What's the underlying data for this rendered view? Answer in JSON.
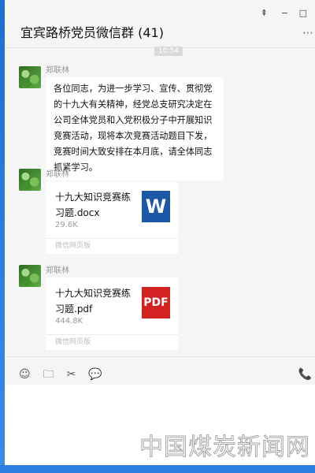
{
  "window": {
    "title": "宜宾路桥党员微信群 (41)",
    "controls": {
      "pin": "⇞",
      "minimize": "−",
      "maximize": "□",
      "more": "⋯"
    }
  },
  "time_label": "10:54",
  "messages": [
    {
      "sender": "郑联林",
      "type": "text",
      "text": "各位同志，为进一步学习、宣传、贯彻党的十九大有关精神，经党总支研究决定在公司全体党员和入党积极分子中开展知识竞赛活动，现将本次竞赛活动题目下发，竞赛时间大致安排在本月底，请全体同志抓紧学习。"
    },
    {
      "sender": "郑联林",
      "type": "file",
      "file_name": "十九大知识竞赛练习题.docx",
      "file_size": "29.6K",
      "source": "微信网页版",
      "icon_label": "W"
    },
    {
      "sender": "郑联林",
      "type": "file",
      "file_name": "十九大知识竞赛练习题.pdf",
      "file_size": "444.8K",
      "source": "微信网页版",
      "icon_label": "PDF"
    }
  ],
  "toolbar": {
    "emoji": "☺",
    "folder": "🗀",
    "scissors": "✂",
    "chat": "💬",
    "call": "📞"
  },
  "watermark": "中国煤炭新闻网"
}
